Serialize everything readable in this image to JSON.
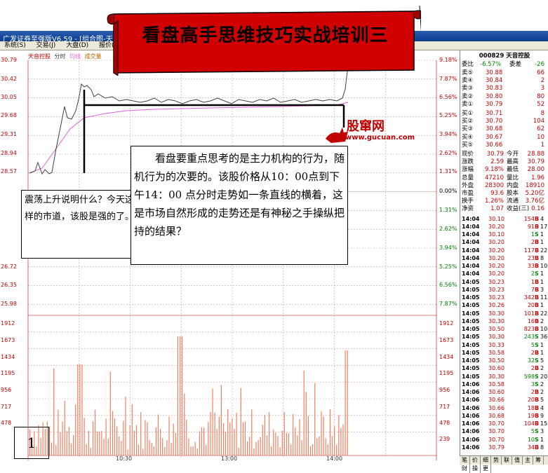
{
  "window": {
    "title": "广发证券至强版V6.59 - [组合图-天音控股]"
  },
  "menu": [
    "系统(S)",
    "交易(J)",
    "大盘(D)",
    "报价(Q)"
  ],
  "banner": {
    "title": "看盘高手思维技巧实战培训三"
  },
  "chart_header": {
    "stock": "天音控股",
    "mode": "分时",
    "ma": "均线",
    "vol": "成交量"
  },
  "price_axis_left": [
    "30.79",
    "30.42",
    "30.05",
    "29.68",
    "29.31",
    "28.94",
    "28.57",
    "26.72",
    "26.35",
    "25.98"
  ],
  "pct_axis_right": [
    "9.18%",
    "7.87%",
    "6.56%",
    "5.25%",
    "3.94%",
    "2.62%",
    "1.31%",
    "0.00%",
    "1.31%",
    "2.62%",
    "3.94%",
    "5.25%",
    "6.56%",
    "7.87%"
  ],
  "vol_axis": [
    "1912",
    "1673",
    "1434",
    "1195",
    "956",
    "717",
    "478",
    "239"
  ],
  "time_axis": [
    "10:30",
    "13:00",
    "14:00"
  ],
  "logo": {
    "name": "股窜网",
    "url": "www.gucuan.com"
  },
  "note1": "震荡上升说明什么？今天这样的市道，该股是强的了。",
  "note2": "看盘要重点思考的是主力机构的行为，随机行为的次要的。该股价格从10：00点到下午14：00 点分时走势如一条直线的横着，这是市场自然形成的走势还是有神秘之手操纵把持的结果？",
  "page_number": "1",
  "quote": {
    "code_name": "000829 天音控股",
    "weibi_label": "委比",
    "weibi": "-6.57%",
    "weicha_label": "委差",
    "weicha": "-26",
    "sells": [
      {
        "label": "卖⑤",
        "price": "30.88",
        "vol": "66"
      },
      {
        "label": "卖④",
        "price": "30.84",
        "vol": "2"
      },
      {
        "label": "卖③",
        "price": "30.83",
        "vol": "3"
      },
      {
        "label": "卖②",
        "price": "30.80",
        "vol": "80"
      },
      {
        "label": "卖①",
        "price": "30.79",
        "vol": "52"
      }
    ],
    "buys": [
      {
        "label": "买①",
        "price": "30.71",
        "vol": "8"
      },
      {
        "label": "买②",
        "price": "30.70",
        "vol": "104"
      },
      {
        "label": "买③",
        "price": "30.68",
        "vol": "62"
      },
      {
        "label": "买④",
        "price": "30.67",
        "vol": "10"
      },
      {
        "label": "买⑤",
        "price": "30.66",
        "vol": "1"
      }
    ],
    "stats": [
      {
        "l1": "现价",
        "v1": "30.79",
        "l2": "今开",
        "v2": "28.88"
      },
      {
        "l1": "涨跌",
        "v1": "2.59",
        "l2": "最高",
        "v2": "30.79"
      },
      {
        "l1": "涨幅",
        "v1": "9.18%",
        "l2": "最低",
        "v2": "28.00"
      },
      {
        "l1": "总量",
        "v1": "47210",
        "l2": "量比",
        "v2": "1.96"
      },
      {
        "l1": "外盘",
        "v1": "28300",
        "l2": "内盘",
        "v2": "18910"
      },
      {
        "l1": "市盈",
        "v1": "93.6",
        "l2": "股本",
        "v2": "5.20亿"
      },
      {
        "l1": "换手",
        "v1": "1.26%",
        "l2": "流通",
        "v2": "3.76亿"
      },
      {
        "l1": "净资",
        "v1": "1.07",
        "l2": "收益(三)",
        "v2": "0.16"
      }
    ],
    "ticks": [
      [
        "14:04",
        "30.10",
        "154",
        "B",
        "4"
      ],
      [
        "14:04",
        "30.20",
        "91",
        "B",
        "17"
      ],
      [
        "14:04",
        "30.10",
        "1",
        "S",
        "1"
      ],
      [
        "14:04",
        "30.20",
        "2",
        "B",
        "1"
      ],
      [
        "14:04",
        "30.20",
        "117",
        "B",
        "22"
      ],
      [
        "14:04",
        "30.20",
        "23",
        "B",
        "8"
      ],
      [
        "14:04",
        "30.20",
        "33",
        "B",
        "10"
      ],
      [
        "14:04",
        "30.20",
        "2",
        "S",
        "1"
      ],
      [
        "14:05",
        "30.23",
        "1",
        "B",
        "1"
      ],
      [
        "14:05",
        "30.23",
        "7",
        "B",
        "3"
      ],
      [
        "14:05",
        "30.23",
        "342",
        "B",
        "11"
      ],
      [
        "14:05",
        "30.26",
        "20",
        "B",
        "1"
      ],
      [
        "14:05",
        "30.30",
        "101",
        "B",
        "22"
      ],
      [
        "14:05",
        "30.30",
        "16",
        "B",
        "2"
      ],
      [
        "14:05",
        "30.50",
        "823",
        "B",
        "103"
      ],
      [
        "14:05",
        "30.30",
        "243",
        "S",
        "36"
      ],
      [
        "14:05",
        "30.33",
        "5",
        "S",
        "1"
      ],
      [
        "14:05",
        "30.58",
        "2",
        "B",
        "1"
      ],
      [
        "14:05",
        "30.50",
        "32",
        "S",
        "5"
      ],
      [
        "14:05",
        "30.60",
        "2",
        "B",
        "2"
      ],
      [
        "14:05",
        "30.30",
        "598",
        "S",
        "20"
      ],
      [
        "14:06",
        "30.58",
        "3",
        "S",
        "2"
      ],
      [
        "14:06",
        "30.60",
        "2",
        "B",
        "2"
      ],
      [
        "14:06",
        "30.66",
        "20",
        "B",
        "5"
      ],
      [
        "14:06",
        "30.66",
        "18",
        "B",
        "4"
      ],
      [
        "14:06",
        "30.68",
        "19",
        "B",
        "9"
      ],
      [
        "14:06",
        "30.70",
        "104",
        "B",
        "15"
      ],
      [
        "14:06",
        "30.70",
        "5",
        "S",
        "3"
      ],
      [
        "14:06",
        "30.70",
        "10",
        "S",
        "1"
      ],
      [
        "14:06",
        "30.79",
        "34",
        "B",
        "8"
      ]
    ]
  },
  "tabs": [
    "笔",
    "价",
    "细",
    "势",
    "联",
    "值",
    "主",
    "筹",
    "财",
    "操",
    "更"
  ],
  "colors": {
    "up": "#c00000",
    "down": "#008000",
    "price_line": "#404040",
    "avg_line": "#e060e0",
    "volume": "#f08060"
  }
}
